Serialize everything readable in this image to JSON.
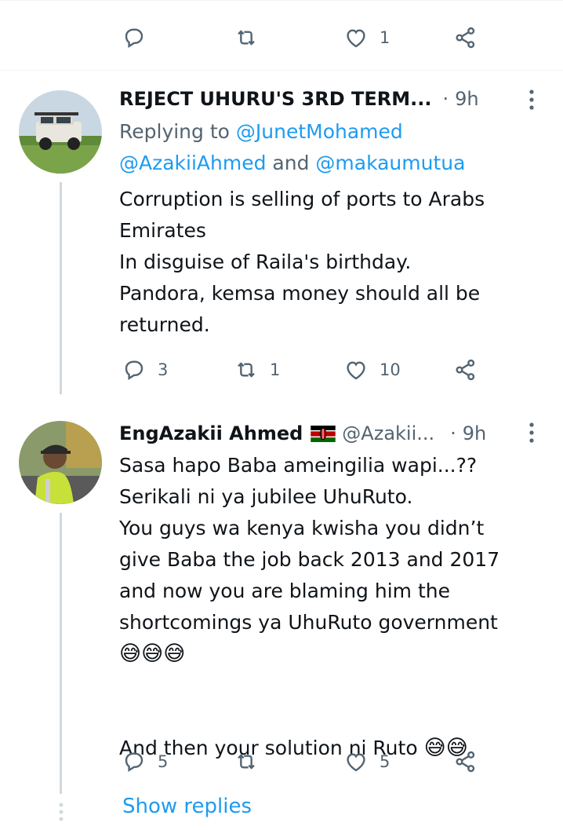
{
  "top_actions": {
    "like_count": "1"
  },
  "tweet1": {
    "name": "REJECT UHURU'S 3RD TERM...",
    "dot": "·",
    "time": "9h",
    "replying_prefix": "Replying to ",
    "replying_user1": "@JunetMohamed",
    "replying_user2": "@AzakiiAhmed",
    "replying_and": " and ",
    "replying_user3": "@makaumutua",
    "text": "Corruption is selling of ports to Arabs\nEmirates\nIn disguise of Raila's birthday.\nPandora, kemsa money should all be\nreturned.",
    "reply_count": "3",
    "retweet_count": "1",
    "like_count": "10"
  },
  "tweet2": {
    "name": "EngAzakii Ahmed",
    "handle": "@Azakii...",
    "dot": "·",
    "time": "9h",
    "text": "Sasa hapo Baba ameingilia wapi...??\nSerikali ni ya jubilee UhuRuto.\nYou guys wa kenya kwisha you didn’t\ngive Baba the job back 2013 and 2017\nand now you are blaming him the\nshortcomings ya UhuRuto government",
    "emoji_line": "😅😅😅",
    "text2": "And then your solution ni Ruto ",
    "emoji_end": "😅😅",
    "reply_count": "5",
    "like_count": "5"
  },
  "show_replies": "Show replies",
  "icons": [
    "reply-icon",
    "retweet-icon",
    "like-icon",
    "share-icon",
    "more-icon",
    "kenya-flag-icon"
  ],
  "colors": {
    "link": "#1d9bf0",
    "muted": "#536471",
    "text": "#0f1419"
  }
}
